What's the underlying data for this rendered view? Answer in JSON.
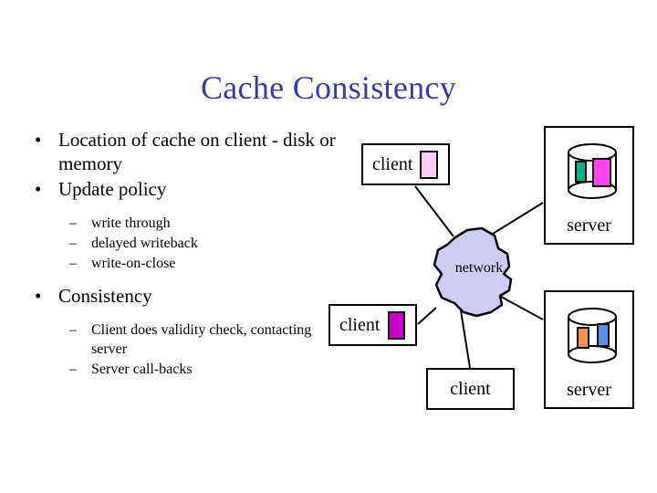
{
  "slide": {
    "title": "Cache Consistency",
    "title_color": "#3b3b9e",
    "background": "#ffffff"
  },
  "content": {
    "bullet_marker": "•",
    "sub_marker": "–",
    "items": [
      {
        "level": 1,
        "text": "Location of cache on client - disk or memory"
      },
      {
        "level": 1,
        "text": "Update policy"
      },
      {
        "level": 2,
        "text": "write through"
      },
      {
        "level": 2,
        "text": "delayed writeback"
      },
      {
        "level": 2,
        "text": "write-on-close"
      },
      {
        "level": 1,
        "text": "Consistency"
      },
      {
        "level": 2,
        "text": "Client does validity check, contacting server"
      },
      {
        "level": 2,
        "text": "Server call-backs"
      }
    ]
  },
  "diagram": {
    "network": {
      "label": "network",
      "fill": "#ccccf5",
      "stroke": "#000000"
    },
    "clients": [
      {
        "id": "client-top",
        "label": "client",
        "cache_chip_color": "#ffccf5",
        "has_cache_chip": true
      },
      {
        "id": "client-middle",
        "label": "client",
        "cache_chip_color": "#cc00cc",
        "has_cache_chip": true
      },
      {
        "id": "client-bottom",
        "label": "client",
        "cache_chip_color": "",
        "has_cache_chip": false
      }
    ],
    "servers": [
      {
        "id": "server-top",
        "label": "server",
        "disk_chips": [
          "#00b386",
          "#ff44ee"
        ]
      },
      {
        "id": "server-bottom",
        "label": "server",
        "disk_chips": [
          "#f89050",
          "#5590e8"
        ]
      }
    ]
  }
}
